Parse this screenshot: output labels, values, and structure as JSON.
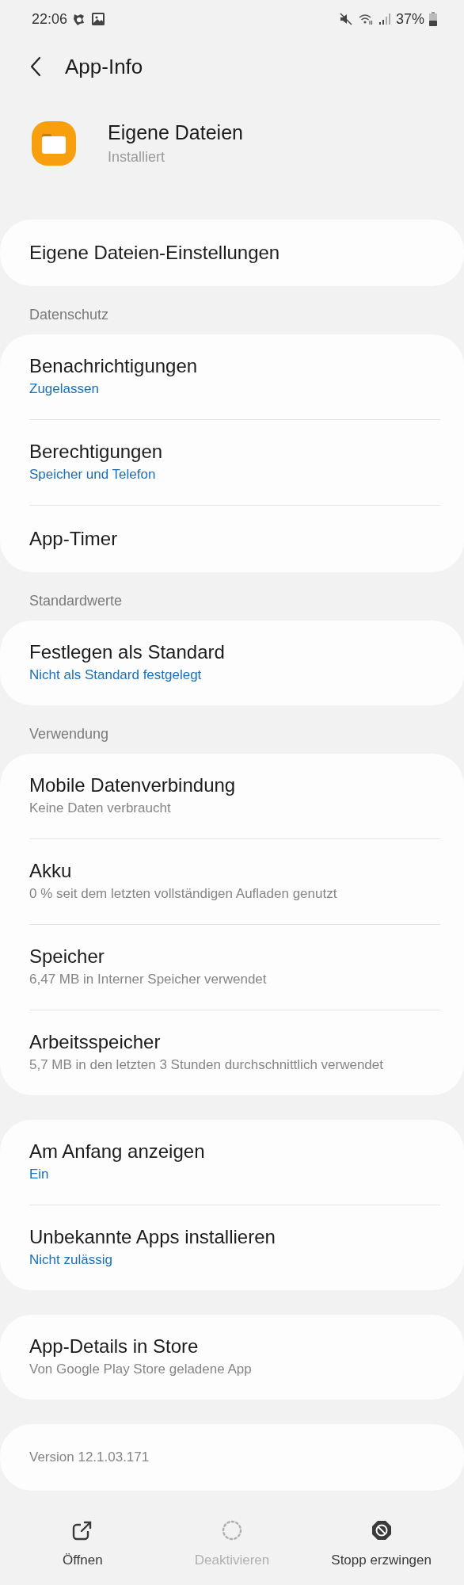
{
  "status_bar": {
    "time": "22:06",
    "battery": "37%"
  },
  "header": {
    "title": "App-Info"
  },
  "app": {
    "name": "Eigene Dateien",
    "state": "Installiert"
  },
  "sections": [
    {
      "items": [
        {
          "title": "Eigene Dateien-Einstellungen"
        }
      ]
    },
    {
      "label": "Datenschutz",
      "items": [
        {
          "title": "Benachrichtigungen",
          "subtitle": "Zugelassen",
          "subtitle_highlighted": true
        },
        {
          "title": "Berechtigungen",
          "subtitle": "Speicher und Telefon",
          "subtitle_highlighted": true
        },
        {
          "title": "App-Timer"
        }
      ]
    },
    {
      "label": "Standardwerte",
      "items": [
        {
          "title": "Festlegen als Standard",
          "subtitle": "Nicht als Standard festgelegt",
          "subtitle_highlighted": true
        }
      ]
    },
    {
      "label": "Verwendung",
      "items": [
        {
          "title": "Mobile Datenverbindung",
          "subtitle": "Keine Daten verbraucht",
          "subtitle_highlighted": false
        },
        {
          "title": "Akku",
          "subtitle": "0 % seit dem letzten vollständigen Aufladen genutzt",
          "subtitle_highlighted": false
        },
        {
          "title": "Speicher",
          "subtitle": "6,47 MB in Interner Speicher verwendet",
          "subtitle_highlighted": false
        },
        {
          "title": "Arbeitsspeicher",
          "subtitle": "5,7 MB in den letzten 3 Stunden durchschnittlich verwendet",
          "subtitle_highlighted": false
        }
      ]
    },
    {
      "items": [
        {
          "title": "Am Anfang anzeigen",
          "subtitle": "Ein",
          "subtitle_highlighted": true
        },
        {
          "title": "Unbekannte Apps installieren",
          "subtitle": "Nicht zulässig",
          "subtitle_highlighted": true
        }
      ]
    },
    {
      "items": [
        {
          "title": "App-Details in Store",
          "subtitle": "Von Google Play Store geladene App",
          "subtitle_highlighted": false
        }
      ]
    }
  ],
  "version": "Version 12.1.03.171",
  "actions": [
    {
      "kind": "open",
      "label": "Öffnen",
      "disabled": false
    },
    {
      "kind": "deactivate",
      "label": "Deaktivieren",
      "disabled": true
    },
    {
      "kind": "stop",
      "label": "Stopp erzwingen",
      "disabled": false
    }
  ]
}
